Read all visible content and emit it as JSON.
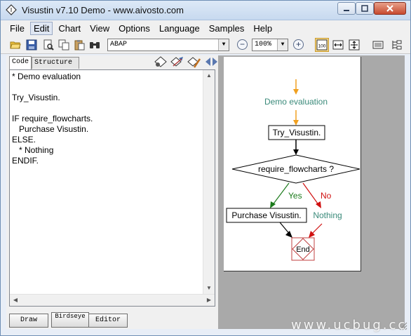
{
  "window": {
    "title": "Visustin v7.10 Demo - www.aivosto.com"
  },
  "menu": [
    "File",
    "Edit",
    "Chart",
    "View",
    "Options",
    "Language",
    "Samples",
    "Help"
  ],
  "menu_active": "Edit",
  "toolbar": {
    "language": "ABAP",
    "zoom": "100%",
    "zoom_toggle_label": "100"
  },
  "tabs": {
    "code": "Code",
    "structure": "Structure"
  },
  "code_lines": [
    "* Demo evaluation",
    "",
    "Try_Visustin.",
    "",
    "IF require_flowcharts.",
    "   Purchase Visustin.",
    "ELSE.",
    "   * Nothing",
    "ENDIF."
  ],
  "buttons": {
    "draw": "Draw",
    "birdseye": "Birdseye",
    "editor": "Editor"
  },
  "flowchart": {
    "comment": "Demo evaluation",
    "process1": "Try_Visustin.",
    "decision": "require_flowcharts ?",
    "yes_label": "Yes",
    "no_label": "No",
    "yes_action": "Purchase Visustin.",
    "no_action": "Nothing",
    "end": "End"
  },
  "colors": {
    "arrow_orange": "#f0a020",
    "yes_green": "#1a7a1a",
    "no_red": "#d01010",
    "teal_text": "#3a8a7a",
    "end_border": "#c04040"
  },
  "watermark": "www.ucbug.cc"
}
